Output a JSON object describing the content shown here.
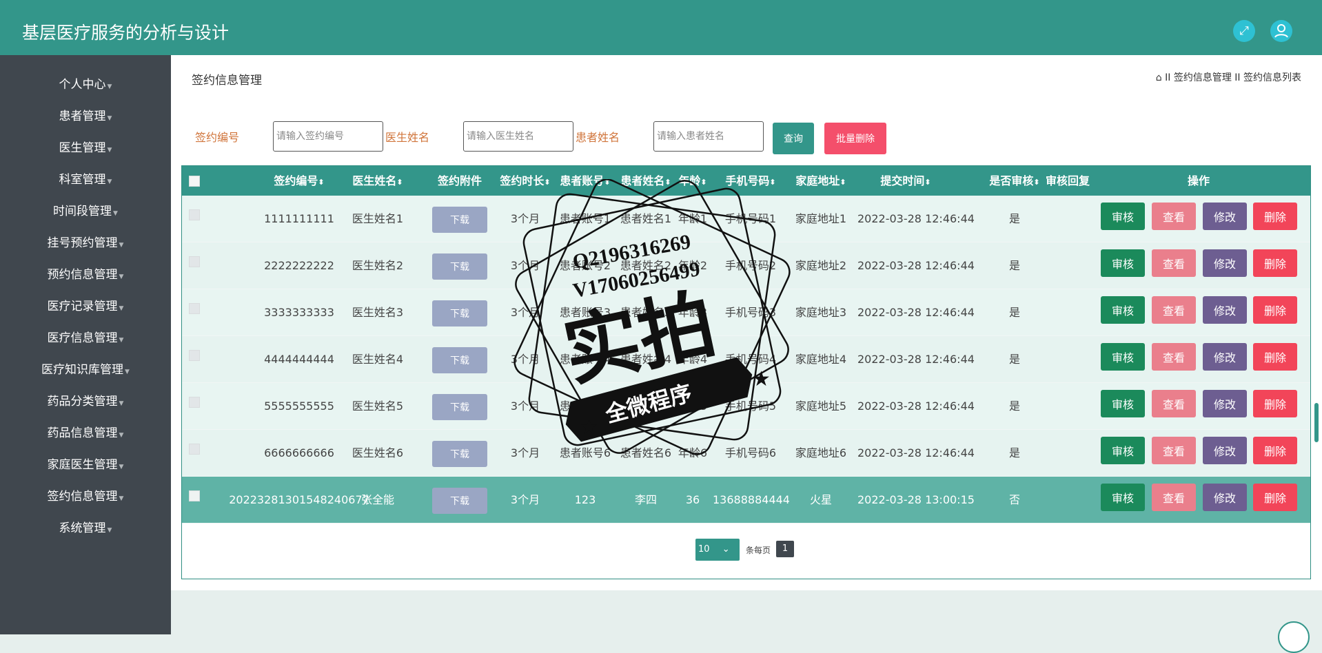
{
  "app": {
    "title": "基层医疗服务的分析与设计"
  },
  "header_icons": [
    "fullscreen-icon",
    "user-icon"
  ],
  "sidebar": {
    "items": [
      {
        "label": "个人中心"
      },
      {
        "label": "患者管理"
      },
      {
        "label": "医生管理"
      },
      {
        "label": "科室管理"
      },
      {
        "label": "时间段管理"
      },
      {
        "label": "挂号预约管理"
      },
      {
        "label": "预约信息管理"
      },
      {
        "label": "医疗记录管理"
      },
      {
        "label": "医疗信息管理"
      },
      {
        "label": "医疗知识库管理"
      },
      {
        "label": "药品分类管理"
      },
      {
        "label": "药品信息管理"
      },
      {
        "label": "家庭医生管理"
      },
      {
        "label": "签约信息管理"
      },
      {
        "label": "系统管理"
      }
    ]
  },
  "main": {
    "title": "签约信息管理",
    "breadcrumb": {
      "separator": "II",
      "section": "签约信息管理",
      "page": "签约信息列表"
    }
  },
  "filters": {
    "sign_no": {
      "label": "签约编号",
      "placeholder": "请输入签约编号"
    },
    "doctor_name": {
      "label": "医生姓名",
      "placeholder": "请输入医生姓名"
    },
    "patient_name": {
      "label": "患者姓名",
      "placeholder": "请输入患者姓名"
    },
    "query_label": "查询",
    "batch_delete_label": "批量删除"
  },
  "table": {
    "columns": [
      "签约编号",
      "医生姓名",
      "签约附件",
      "签约时长",
      "患者账号",
      "患者姓名",
      "年龄",
      "手机号码",
      "家庭地址",
      "提交时间",
      "是否审核",
      "审核回复",
      "操作"
    ],
    "download_label": "下载",
    "actions": {
      "audit": "审核",
      "view": "查看",
      "edit": "修改",
      "delete": "删除"
    },
    "rows": [
      {
        "sign_no": "1111111111",
        "doctor": "医生姓名1",
        "duration": "3个月",
        "account": "患者账号1",
        "patient": "患者姓名1",
        "age": "年龄1",
        "phone": "手机号码1",
        "address": "家庭地址1",
        "time": "2022-03-28 12:46:44",
        "audited": "是",
        "reply": ""
      },
      {
        "sign_no": "2222222222",
        "doctor": "医生姓名2",
        "duration": "3个月",
        "account": "患者账号2",
        "patient": "患者姓名2",
        "age": "年龄2",
        "phone": "手机号码2",
        "address": "家庭地址2",
        "time": "2022-03-28 12:46:44",
        "audited": "是",
        "reply": ""
      },
      {
        "sign_no": "3333333333",
        "doctor": "医生姓名3",
        "duration": "3个月",
        "account": "患者账号3",
        "patient": "患者姓名3",
        "age": "年龄3",
        "phone": "手机号码3",
        "address": "家庭地址3",
        "time": "2022-03-28 12:46:44",
        "audited": "是",
        "reply": ""
      },
      {
        "sign_no": "4444444444",
        "doctor": "医生姓名4",
        "duration": "3个月",
        "account": "患者账号4",
        "patient": "患者姓名4",
        "age": "年龄4",
        "phone": "手机号码4",
        "address": "家庭地址4",
        "time": "2022-03-28 12:46:44",
        "audited": "是",
        "reply": ""
      },
      {
        "sign_no": "5555555555",
        "doctor": "医生姓名5",
        "duration": "3个月",
        "account": "患者账号5",
        "patient": "患者姓名5",
        "age": "年龄5",
        "phone": "手机号码5",
        "address": "家庭地址5",
        "time": "2022-03-28 12:46:44",
        "audited": "是",
        "reply": ""
      },
      {
        "sign_no": "6666666666",
        "doctor": "医生姓名6",
        "duration": "3个月",
        "account": "患者账号6",
        "patient": "患者姓名6",
        "age": "年龄6",
        "phone": "手机号码6",
        "address": "家庭地址6",
        "time": "2022-03-28 12:46:44",
        "audited": "是",
        "reply": ""
      },
      {
        "sign_no": "20223281301548240677",
        "doctor": "张全能",
        "duration": "3个月",
        "account": "123",
        "patient": "李四",
        "age": "36",
        "phone": "13688884444",
        "address": "火星",
        "time": "2022-03-28 13:00:15",
        "audited": "否",
        "reply": ""
      }
    ]
  },
  "pagination": {
    "page_size": "10",
    "per_page_text": "条每页",
    "current_page": "1"
  },
  "watermark": {
    "line1": "Q2196316269",
    "line2": "V17060256499",
    "big": "实拍",
    "ribbon": "全微程序"
  },
  "colors": {
    "primary": "#33968a",
    "danger": "#f44f6b",
    "sidebar": "#40474e",
    "label": "#d0743a"
  }
}
